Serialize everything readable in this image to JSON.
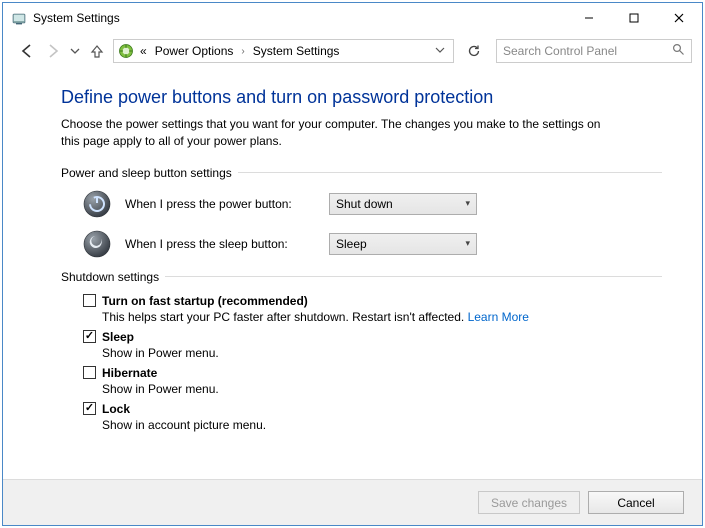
{
  "window": {
    "title": "System Settings"
  },
  "breadcrumb": {
    "prefix": "«",
    "seg1": "Power Options",
    "seg2": "System Settings"
  },
  "search": {
    "placeholder": "Search Control Panel"
  },
  "heading": "Define power buttons and turn on password protection",
  "description": "Choose the power settings that you want for your computer. The changes you make to the settings on this page apply to all of your power plans.",
  "group_power": "Power and sleep button settings",
  "row_power": {
    "label": "When I press the power button:",
    "value": "Shut down"
  },
  "row_sleep": {
    "label": "When I press the sleep button:",
    "value": "Sleep"
  },
  "group_shutdown": "Shutdown settings",
  "opt_fast": {
    "label": "Turn on fast startup (recommended)",
    "desc": "This helps start your PC faster after shutdown. Restart isn't affected. ",
    "link": "Learn More"
  },
  "opt_sleep": {
    "label": "Sleep",
    "desc": "Show in Power menu."
  },
  "opt_hibernate": {
    "label": "Hibernate",
    "desc": "Show in Power menu."
  },
  "opt_lock": {
    "label": "Lock",
    "desc": "Show in account picture menu."
  },
  "buttons": {
    "save": "Save changes",
    "cancel": "Cancel"
  }
}
